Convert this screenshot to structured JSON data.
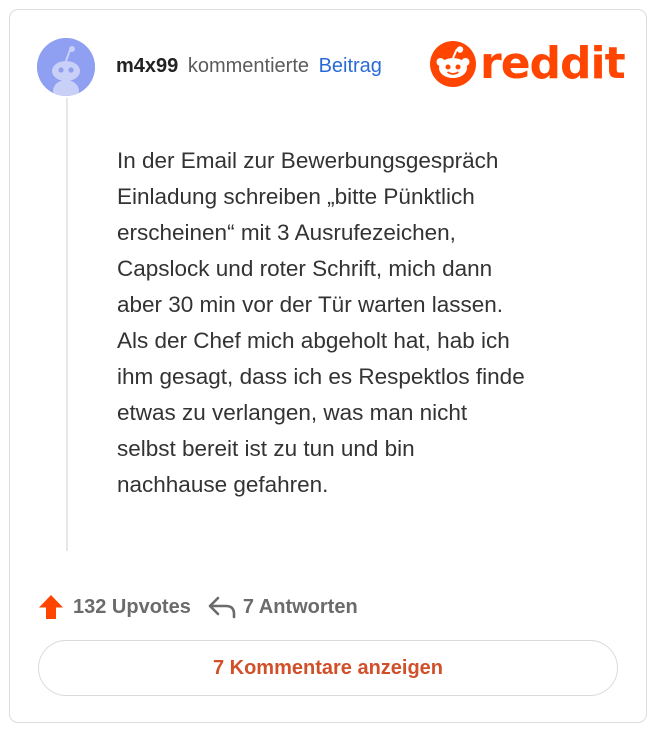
{
  "post": {
    "username": "m4x99",
    "action_text": "kommentierte",
    "post_link": "Beitrag",
    "brand": "reddit",
    "body_lines": [
      "In der Email zur Bewerbungsgespräch",
      "Einladung schreiben „bitte Pünktlich",
      "erscheinen“ mit 3 Ausrufezeichen,",
      "Capslock und roter Schrift, mich dann",
      "aber 30 min vor der Tür warten lassen.",
      "Als der Chef mich abgeholt hat, hab ich",
      "ihm gesagt, dass ich es Respektlos finde",
      "etwas zu verlangen, was man nicht",
      "selbst bereit ist zu tun und bin",
      "nachhause gefahren."
    ]
  },
  "actions": {
    "upvotes_label": "132 Upvotes",
    "replies_label": "7 Antworten",
    "comments_button": "7 Kommentare anzeigen"
  },
  "icons": {
    "avatar": "reddit-snoo-avatar",
    "logo": "reddit-logo",
    "upvote": "upvote-arrow-icon",
    "reply": "reply-arrow-icon"
  },
  "colors": {
    "brand": "#ff4500",
    "upvote": "#ff4500",
    "avatar_bg": "#8f9ff2",
    "link": "#2a6bd6",
    "comments_button_text": "#d1502a"
  }
}
